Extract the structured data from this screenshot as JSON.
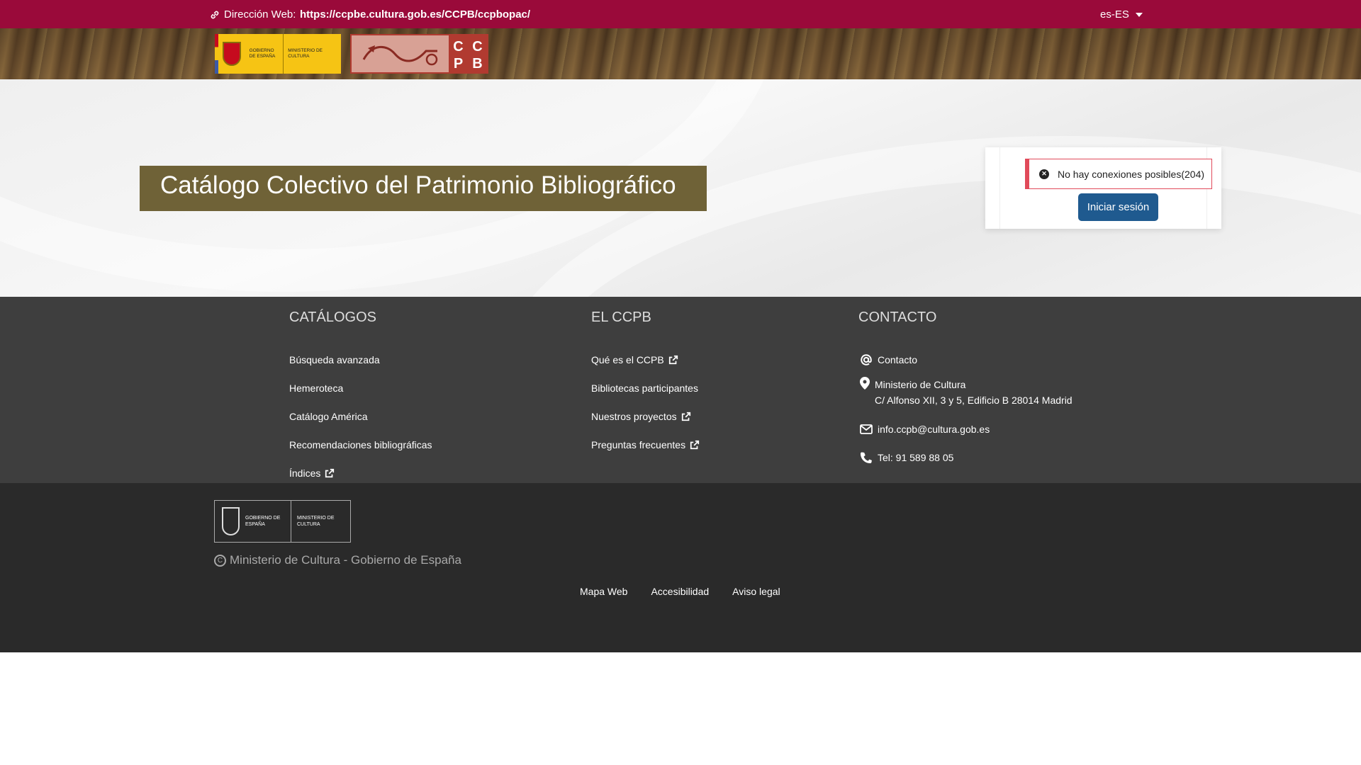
{
  "topbar": {
    "address_label": "Dirección Web:",
    "url": "https://ccpbe.cultura.gob.es/CCPB/ccpbopac/",
    "language": "es-ES"
  },
  "logos": {
    "gov_line1": "GOBIERNO DE ESPAÑA",
    "gov_line2": "MINISTERIO DE CULTURA",
    "ccpb_letters": [
      "C",
      "C",
      "P",
      "B"
    ]
  },
  "hero": {
    "title": "Catálogo Colectivo del Patrimonio Bibliográfico"
  },
  "login": {
    "alert": "No hay conexiones posibles(204)",
    "button": "Iniciar sesión"
  },
  "footer": {
    "catalogs": {
      "heading": "CATÁLOGOS",
      "items": [
        "Búsqueda avanzada",
        "Hemeroteca",
        "Catálogo América",
        "Recomendaciones bibliográficas",
        "Índices"
      ]
    },
    "ccpb": {
      "heading": "EL CCPB",
      "items": [
        "Qué es el CCPB",
        "Bibliotecas participantes",
        "Nuestros proyectos",
        "Preguntas frecuentes"
      ]
    },
    "contact": {
      "heading": "CONTACTO",
      "contact_link": "Contacto",
      "address_line1": "Ministerio de Cultura",
      "address_line2": "C/ Alfonso XII, 3 y 5, Edificio B 28014 Madrid",
      "email": "info.ccpb@cultura.gob.es",
      "phone": "Tel: 91 589 88 05"
    }
  },
  "bottom": {
    "copyright": "Ministerio de Cultura - Gobierno de España",
    "links": [
      "Mapa Web",
      "Accesibilidad",
      "Aviso legal"
    ]
  },
  "colors": {
    "topbar": "#9a0a3a",
    "hero_title_bg": "#6f6237",
    "login_button": "#1f5a8f",
    "alert_border": "#e14a5a",
    "footer_bg": "#3e3e3e",
    "footer_bottom_bg": "#2a2a2a"
  }
}
